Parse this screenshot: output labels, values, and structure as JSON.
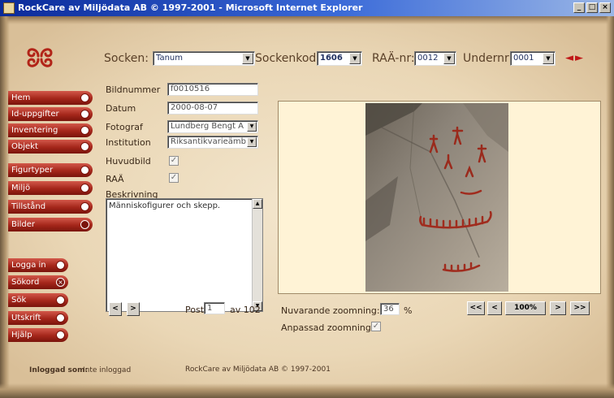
{
  "window": {
    "title": "RockCare av Miljödata AB © 1997-2001 - Microsoft Internet Explorer"
  },
  "top_selectors": {
    "socken_label": "Socken:",
    "socken_value": "Tanum",
    "sockenkod_label": "Sockenkod:",
    "sockenkod_value": "1606",
    "raa_nr_label": "RAÄ-nr:",
    "raa_nr_value": "0012",
    "undernr_label": "Undernr:",
    "undernr_value": "0001"
  },
  "sidebar": {
    "main_items": [
      "Hem",
      "Id-uppgifter",
      "Inventering",
      "Objekt",
      "Figurtyper",
      "Miljö",
      "Tillstånd",
      "Bilder"
    ],
    "tool_items": [
      "Logga in",
      "Sökord",
      "Sök",
      "Utskrift",
      "Hjälp"
    ]
  },
  "form": {
    "bildnummer_label": "Bildnummer",
    "bildnummer_value": "f0010516",
    "datum_label": "Datum",
    "datum_value": "2000-08-07",
    "fotograf_label": "Fotograf",
    "fotograf_value": "Lundberg Bengt A",
    "institution_label": "Institution",
    "institution_value": "Riksantikvarieämb",
    "huvudbild_label": "Huvudbild",
    "huvudbild_checked": true,
    "raa_label": "RAÄ",
    "raa_checked": true,
    "beskrivning_label": "Beskrivning",
    "beskrivning_value": "Människofigurer och skepp."
  },
  "pager": {
    "prev_label": "<",
    "next_label": ">",
    "post_label": "Post",
    "post_value": "1",
    "of_label": "av 102"
  },
  "zoom": {
    "current_label": "Nuvarande zoomning:",
    "current_value": "36",
    "percent_label": "%",
    "fit_label": "Anpassad zoomning",
    "fit_checked": true,
    "first_label": "<<",
    "back_label": "<",
    "hundred_label": "100%",
    "forward_label": ">",
    "last_label": ">>"
  },
  "footer": {
    "logged_in_label": "Inloggad som:",
    "logged_in_value": "Inte inloggad",
    "copyright": "RockCare av Miljödata AB © 1997-2001"
  },
  "colors": {
    "accent": "#a4261a",
    "parchment": "#ead7b6",
    "titlebar": "#0a2a9a"
  }
}
